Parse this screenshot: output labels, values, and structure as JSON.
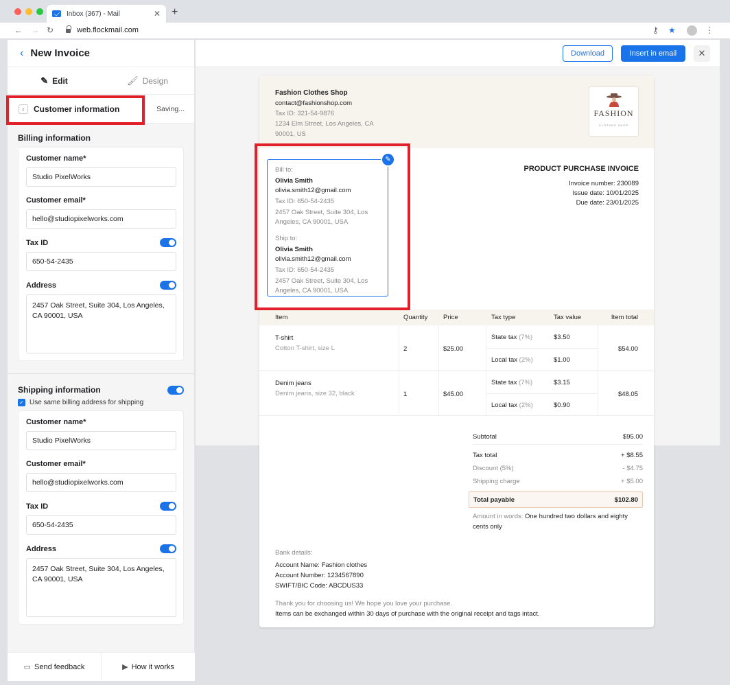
{
  "browser": {
    "tab_title": "Inbox (367) - Mail",
    "url": "web.flockmail.com",
    "close_glyph": "✕",
    "newtab_glyph": "+"
  },
  "left": {
    "title": "New Invoice",
    "modes": [
      "Edit",
      "Design"
    ],
    "section_title": "Customer information",
    "saving": "Saving...",
    "billing": {
      "title": "Billing information",
      "name_label": "Customer name*",
      "name_value": "Studio PixelWorks",
      "email_label": "Customer email*",
      "email_value": "hello@studiopixelworks.com",
      "taxid_label": "Tax ID",
      "taxid_value": "650-54-2435",
      "address_label": "Address",
      "address_value": "2457 Oak Street, Suite 304, Los Angeles, CA 90001, USA"
    },
    "shipping": {
      "title": "Shipping information",
      "same_address": "Use same billing address for shipping",
      "name_label": "Customer name*",
      "name_value": "Studio PixelWorks",
      "email_label": "Customer email*",
      "email_value": "hello@studiopixelworks.com",
      "taxid_label": "Tax ID",
      "taxid_value": "650-54-2435",
      "address_label": "Address",
      "address_value": "2457 Oak Street, Suite 304, Los Angeles, CA 90001, USA"
    },
    "footer": {
      "feedback": "Send feedback",
      "how": "How it works"
    }
  },
  "toolbar": {
    "download": "Download",
    "insert": "Insert in email",
    "close": "✕"
  },
  "invoice": {
    "shop_name": "Fashion Clothes Shop",
    "shop_email": "contact@fashionshop.com",
    "shop_tax": "Tax ID: 321-54-9876",
    "shop_addr1": "1234 Elm Street, Los Angeles, CA",
    "shop_addr2": "90001, US",
    "logo_word": "FASHION",
    "logo_sub": "CLOTHES SHOP",
    "bill_label": "Bill to:",
    "bill_name": "Olivia Smith",
    "bill_email": "olivia.smith12@gmail.com",
    "bill_tax": "Tax ID: 650-54-2435",
    "bill_addr1": "2457 Oak Street, Suite 304, Los",
    "bill_addr2": "Angeles, CA 90001, USA",
    "ship_label": "Ship to:",
    "ship_name": "Olivia Smith",
    "ship_email": "olivia.smith12@gmail.com",
    "ship_tax": "Tax ID: 650-54-2435",
    "ship_addr1": "2457 Oak Street, Suite 304, Los",
    "ship_addr2": "Angeles, CA 90001, USA",
    "title": "PRODUCT PURCHASE INVOICE",
    "number": "Invoice number: 230089",
    "issue": "Issue date: 10/01/2025",
    "due": "Due date: 23/01/2025",
    "columns": [
      "Item",
      "Quantity",
      "Price",
      "Tax type",
      "Tax value",
      "Item total"
    ],
    "items": [
      {
        "name": "T-shirt",
        "desc": "Cotton T-shirt, size L",
        "qty": "2",
        "price": "$25.00",
        "tax1_type": "State tax",
        "tax1_rate": "(7%)",
        "tax1_value": "$3.50",
        "tax2_type": "Local tax",
        "tax2_rate": "(2%)",
        "tax2_value": "$1.00",
        "total": "$54.00"
      },
      {
        "name": "Denim jeans",
        "desc": "Denim jeans, size 32, black",
        "qty": "1",
        "price": "$45.00",
        "tax1_type": "State tax",
        "tax1_rate": "(7%)",
        "tax1_value": "$3.15",
        "tax2_type": "Local tax",
        "tax2_rate": "(2%)",
        "tax2_value": "$0.90",
        "total": "$48.05"
      }
    ],
    "subtotal_label": "Subtotal",
    "subtotal": "$95.00",
    "taxtotal_label": "Tax total",
    "taxtotal": "+ $8.55",
    "discount_label": "Discount (5%)",
    "discount": "- $4.75",
    "shipping_label": "Shipping charge",
    "shipping": "+ $5.00",
    "payable_label": "Total payable",
    "payable": "$102.80",
    "words_label": "Amount in words:",
    "words_value": "One hundred two dollars and eighty cents only",
    "bank_label": "Bank details:",
    "bank_name": "Account Name: Fashion clothes",
    "bank_number": "Account Number: 1234567890",
    "bank_swift": "SWIFT/BIC Code: ABCDUS33",
    "thanks1": "Thank you for choosing us! We hope you love your purchase.",
    "thanks2": "Items can be exchanged within 30 days of purchase with the original receipt and tags intact."
  },
  "colors": {
    "accent": "#1a73e8",
    "highlight": "#e1202a"
  }
}
